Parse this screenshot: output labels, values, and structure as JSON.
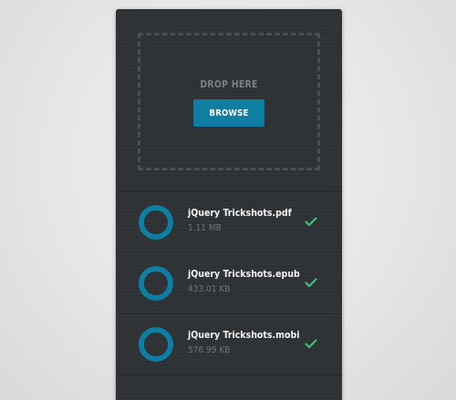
{
  "dropzone": {
    "label": "DROP HERE",
    "browse_label": "BROWSE"
  },
  "colors": {
    "accent": "#0e7fa3",
    "success": "#3ec07a",
    "panel": "#2f3235"
  },
  "files": [
    {
      "name": "jQuery Trickshots.pdf",
      "size": "1.11 MB",
      "progress": 1.0,
      "status_icon": "check-icon"
    },
    {
      "name": "jQuery Trickshots.epub",
      "size": "433.01 KB",
      "progress": 1.0,
      "status_icon": "check-icon"
    },
    {
      "name": "jQuery Trickshots.mobi",
      "size": "576.99 KB",
      "progress": 1.0,
      "status_icon": "check-icon"
    }
  ]
}
